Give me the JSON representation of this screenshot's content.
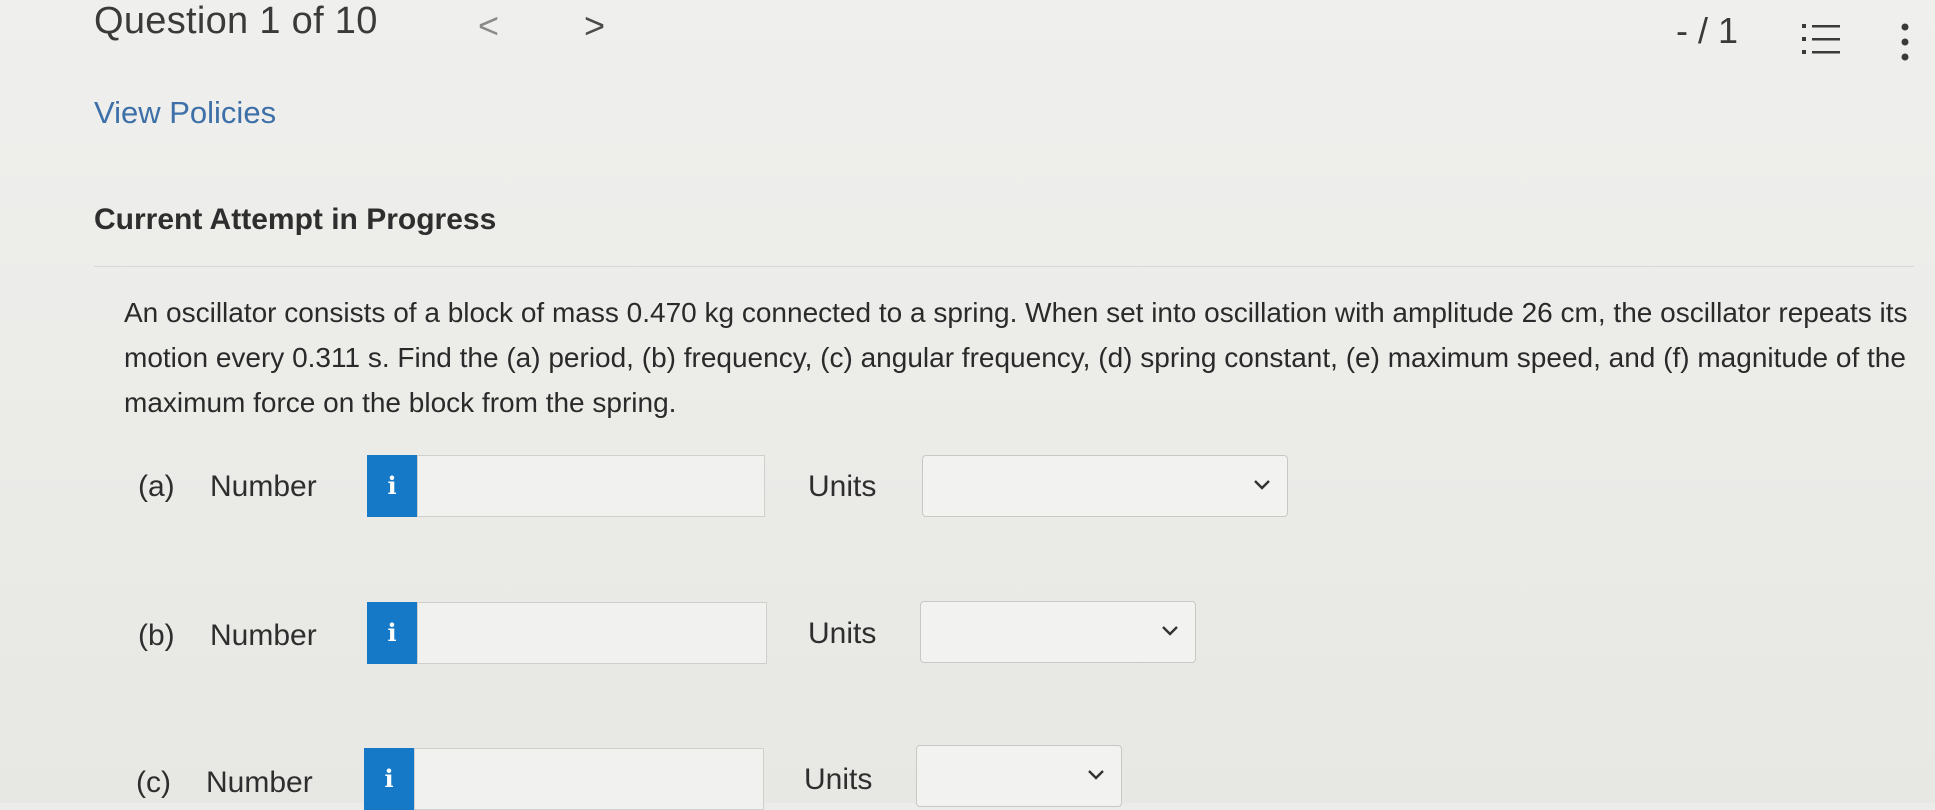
{
  "header": {
    "question_title": "Question 1 of 10",
    "prev_symbol": "<",
    "next_symbol": ">",
    "score": "- / 1"
  },
  "links": {
    "view_policies": "View Policies"
  },
  "status": {
    "attempt": "Current Attempt in Progress"
  },
  "problem": {
    "text": "An oscillator consists of a block of mass 0.470 kg connected to a spring. When set into oscillation with amplitude 26 cm, the oscillator repeats its motion every 0.311 s. Find the (a) period, (b) frequency, (c) angular frequency, (d) spring constant, (e) maximum speed, and (f) magnitude of the maximum force on the block from the spring."
  },
  "parts": [
    {
      "label": "(a)",
      "number_label": "Number",
      "info_icon": "i",
      "value": "",
      "units_label": "Units",
      "units_value": ""
    },
    {
      "label": "(b)",
      "number_label": "Number",
      "info_icon": "i",
      "value": "",
      "units_label": "Units",
      "units_value": ""
    },
    {
      "label": "(c)",
      "number_label": "Number",
      "info_icon": "i",
      "value": "",
      "units_label": "Units",
      "units_value": ""
    }
  ],
  "icons": {
    "list": "list-icon",
    "more": "more-vertical-icon",
    "info": "info-icon",
    "dropdown": "chevron-down-icon"
  },
  "colors": {
    "link": "#3d6fa8",
    "info_button": "#1579c8",
    "background": "#ececea"
  }
}
